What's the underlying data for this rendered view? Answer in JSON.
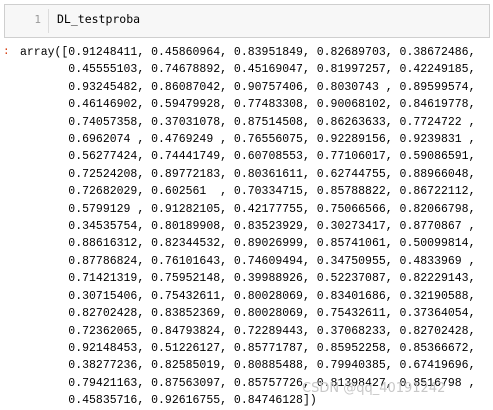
{
  "input_cell": {
    "line_number": "1",
    "code": "DL_testproba"
  },
  "output_cell": {
    "prompt": ":",
    "lines": [
      "array([0.91248411, 0.45860964, 0.83951849, 0.82689703, 0.38672486,",
      "       0.45555103, 0.74678892, 0.45169047, 0.81997257, 0.42249185,",
      "       0.93245482, 0.86087042, 0.90757406, 0.8030743 , 0.89599574,",
      "       0.46146902, 0.59479928, 0.77483308, 0.90068102, 0.84619778,",
      "       0.74057358, 0.37031078, 0.87514508, 0.86263633, 0.7724722 ,",
      "       0.6962074 , 0.4769249 , 0.76556075, 0.92289156, 0.9239831 ,",
      "       0.56277424, 0.74441749, 0.60708553, 0.77106017, 0.59086591,",
      "       0.72524208, 0.89772183, 0.80361611, 0.62744755, 0.88966048,",
      "       0.72682029, 0.602561  , 0.70334715, 0.85788822, 0.86722112,",
      "       0.5799129 , 0.91282105, 0.42177755, 0.75066566, 0.82066798,",
      "       0.34535754, 0.80189908, 0.83523929, 0.30273417, 0.8770867 ,",
      "       0.88616312, 0.82344532, 0.89026999, 0.85741061, 0.50099814,",
      "       0.87786824, 0.76101643, 0.74609494, 0.34750955, 0.4833969 ,",
      "       0.71421319, 0.75952148, 0.39988926, 0.52237087, 0.82229143,",
      "       0.30715406, 0.75432611, 0.80028069, 0.83401686, 0.32190588,",
      "       0.82702428, 0.83852369, 0.80028069, 0.75432611, 0.37364054,",
      "       0.72362065, 0.84793824, 0.72289443, 0.37068233, 0.82702428,",
      "       0.92148453, 0.51226127, 0.85771787, 0.85952258, 0.85366672,",
      "       0.38277236, 0.82585019, 0.80885488, 0.79940385, 0.67419696,",
      "       0.79421163, 0.87563097, 0.85757726, 0.81398427, 0.8516798 ,",
      "       0.45835716, 0.92616755, 0.84746128])"
    ]
  },
  "watermark": "CSDN @qq_40191242"
}
